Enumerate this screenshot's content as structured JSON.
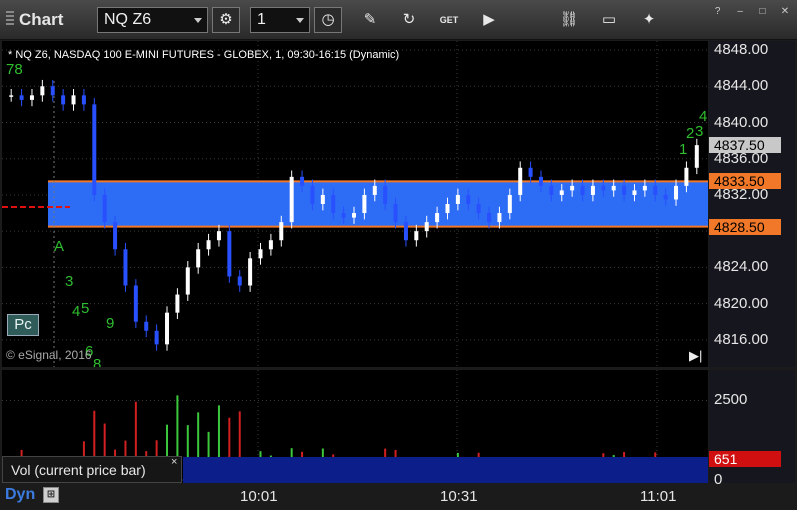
{
  "toolbar": {
    "title": "Chart",
    "symbol": "NQ Z6",
    "interval": "1",
    "icons": [
      "settings-gear-icon",
      "clock-icon",
      "pencil-icon",
      "refresh-icon",
      "get-icon",
      "play-icon",
      "link-icon",
      "comment-icon",
      "twitter-icon"
    ],
    "window_help": "?",
    "window_min": "–",
    "window_max": "□",
    "window_close": "✕"
  },
  "chart": {
    "caption": "* NQ Z6, NASDAQ 100 E-MINI FUTURES - GLOBEX, 1, 09:30-16:15 (Dynamic)",
    "copyright": "© eSignal, 2016",
    "pc_label": "Pc",
    "price_ticks": [
      "4848.00",
      "4844.00",
      "4840.00",
      "4836.00",
      "4832.00",
      "4828.00",
      "4824.00",
      "4820.00",
      "4816.00"
    ],
    "last_price_tag": "4837.50",
    "upper_level_tag": "4833.50",
    "lower_level_tag": "4828.50",
    "volume_ticks": [
      "2500",
      "0"
    ],
    "volume_tag": "651",
    "volume_legend": "Vol (current price bar)",
    "volume_legend_close": "×",
    "time_labels": [
      "10:01",
      "10:31",
      "11:01"
    ],
    "dyn_label": "Dyn",
    "annotations": [
      "78",
      "A",
      "3",
      "4",
      "5",
      "9",
      "6",
      "8",
      "1",
      "2",
      "3",
      "4"
    ],
    "colors": {
      "band": "#2d6cf5",
      "band_line": "#f07828",
      "up_bar": "#ffffff",
      "down_bar": "#2850ff",
      "vol_up": "#3cc83c",
      "vol_down": "#d22020",
      "tag_orange": "#f07828",
      "tag_gray": "#c8c8c8",
      "tag_red": "#d01010"
    }
  },
  "chart_data": {
    "type": "candlestick",
    "y_range": [
      4813,
      4849
    ],
    "upper_level": 4833.5,
    "lower_level": 4828.5,
    "last": 4837.5,
    "time_ticks": [
      "10:01",
      "10:31",
      "11:01"
    ],
    "approx_closes": [
      4843,
      4842.5,
      4843,
      4844,
      4843,
      4842,
      4843,
      4842,
      4832,
      4829,
      4826,
      4822,
      4818,
      4817,
      4815.5,
      4819,
      4821,
      4824,
      4826,
      4827,
      4828,
      4823,
      4822,
      4825,
      4826,
      4827,
      4829,
      4834,
      4833,
      4831,
      4832,
      4830,
      4829.5,
      4830,
      4832,
      4833,
      4831,
      4829,
      4827,
      4828,
      4829,
      4830,
      4831,
      4832,
      4831,
      4830,
      4829,
      4830,
      4832,
      4835,
      4834,
      4833,
      4832,
      4832.5,
      4833,
      4832,
      4833,
      4832.5,
      4833,
      4832,
      4832.5,
      4833,
      4832,
      4831.5,
      4833,
      4835,
      4837.5
    ],
    "volume_max_tick": 2500,
    "volume_last": 651
  }
}
